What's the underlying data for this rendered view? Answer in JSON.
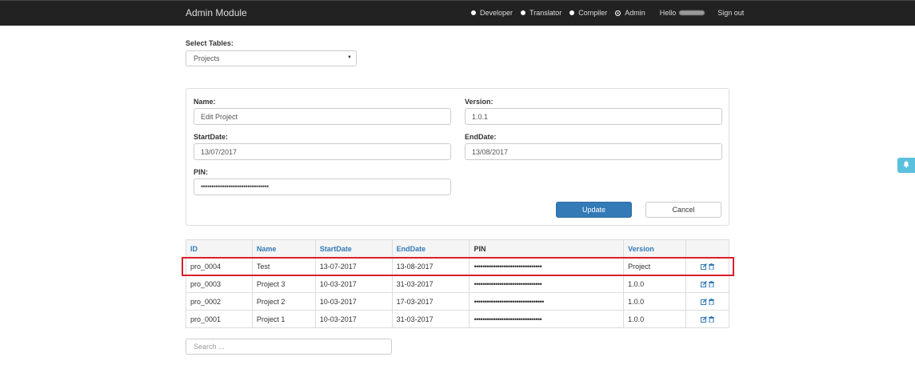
{
  "header": {
    "brand": "Admin Module",
    "roles": [
      {
        "label": "Developer",
        "checked": false
      },
      {
        "label": "Translator",
        "checked": false
      },
      {
        "label": "Compiler",
        "checked": false
      },
      {
        "label": "Admin",
        "checked": true
      }
    ],
    "hello": "Hello",
    "sign_out": "Sign out"
  },
  "select_tables": {
    "label": "Select Tables:",
    "value": "Projects"
  },
  "form": {
    "name_label": "Name:",
    "name_value": "Edit Project",
    "version_label": "Version:",
    "version_value": "1.0.1",
    "start_label": "StartDate:",
    "start_value": "13/07/2017",
    "end_label": "EndDate:",
    "end_value": "13/08/2017",
    "pin_label": "PIN:",
    "pin_value": "••••••••••••••••••••••••••••••••",
    "update_label": "Update",
    "cancel_label": "Cancel"
  },
  "table": {
    "headers": [
      "ID",
      "Name",
      "StartDate",
      "EndDate",
      "PIN",
      "Version"
    ],
    "rows": [
      [
        "pro_0004",
        "Test",
        "13-07-2017",
        "13-08-2017",
        "••••••••••••••••••••••••••••••••",
        "Project"
      ],
      [
        "pro_0003",
        "Project 3",
        "10-03-2017",
        "31-03-2017",
        "••••••••••••••••••••••••••••••••",
        "1.0.0"
      ],
      [
        "pro_0002",
        "Project 2",
        "10-03-2017",
        "17-03-2017",
        "•••••••••••••••••••••••••••••••••",
        "1.0.0"
      ],
      [
        "pro_0001",
        "Project 1",
        "10-03-2017",
        "31-03-2017",
        "••••••••••••••••••••••••••••••••",
        "1.0.0"
      ]
    ]
  },
  "search": {
    "placeholder": "Search ..."
  },
  "icons": {
    "edit": "edit-icon",
    "delete": "trash-icon",
    "bell": "bell-icon",
    "caret": "caret-down-icon"
  },
  "colors": {
    "navbar": "#222222",
    "primary": "#337ab7",
    "highlight": "#d9202b",
    "bell": "#5bc0de"
  }
}
